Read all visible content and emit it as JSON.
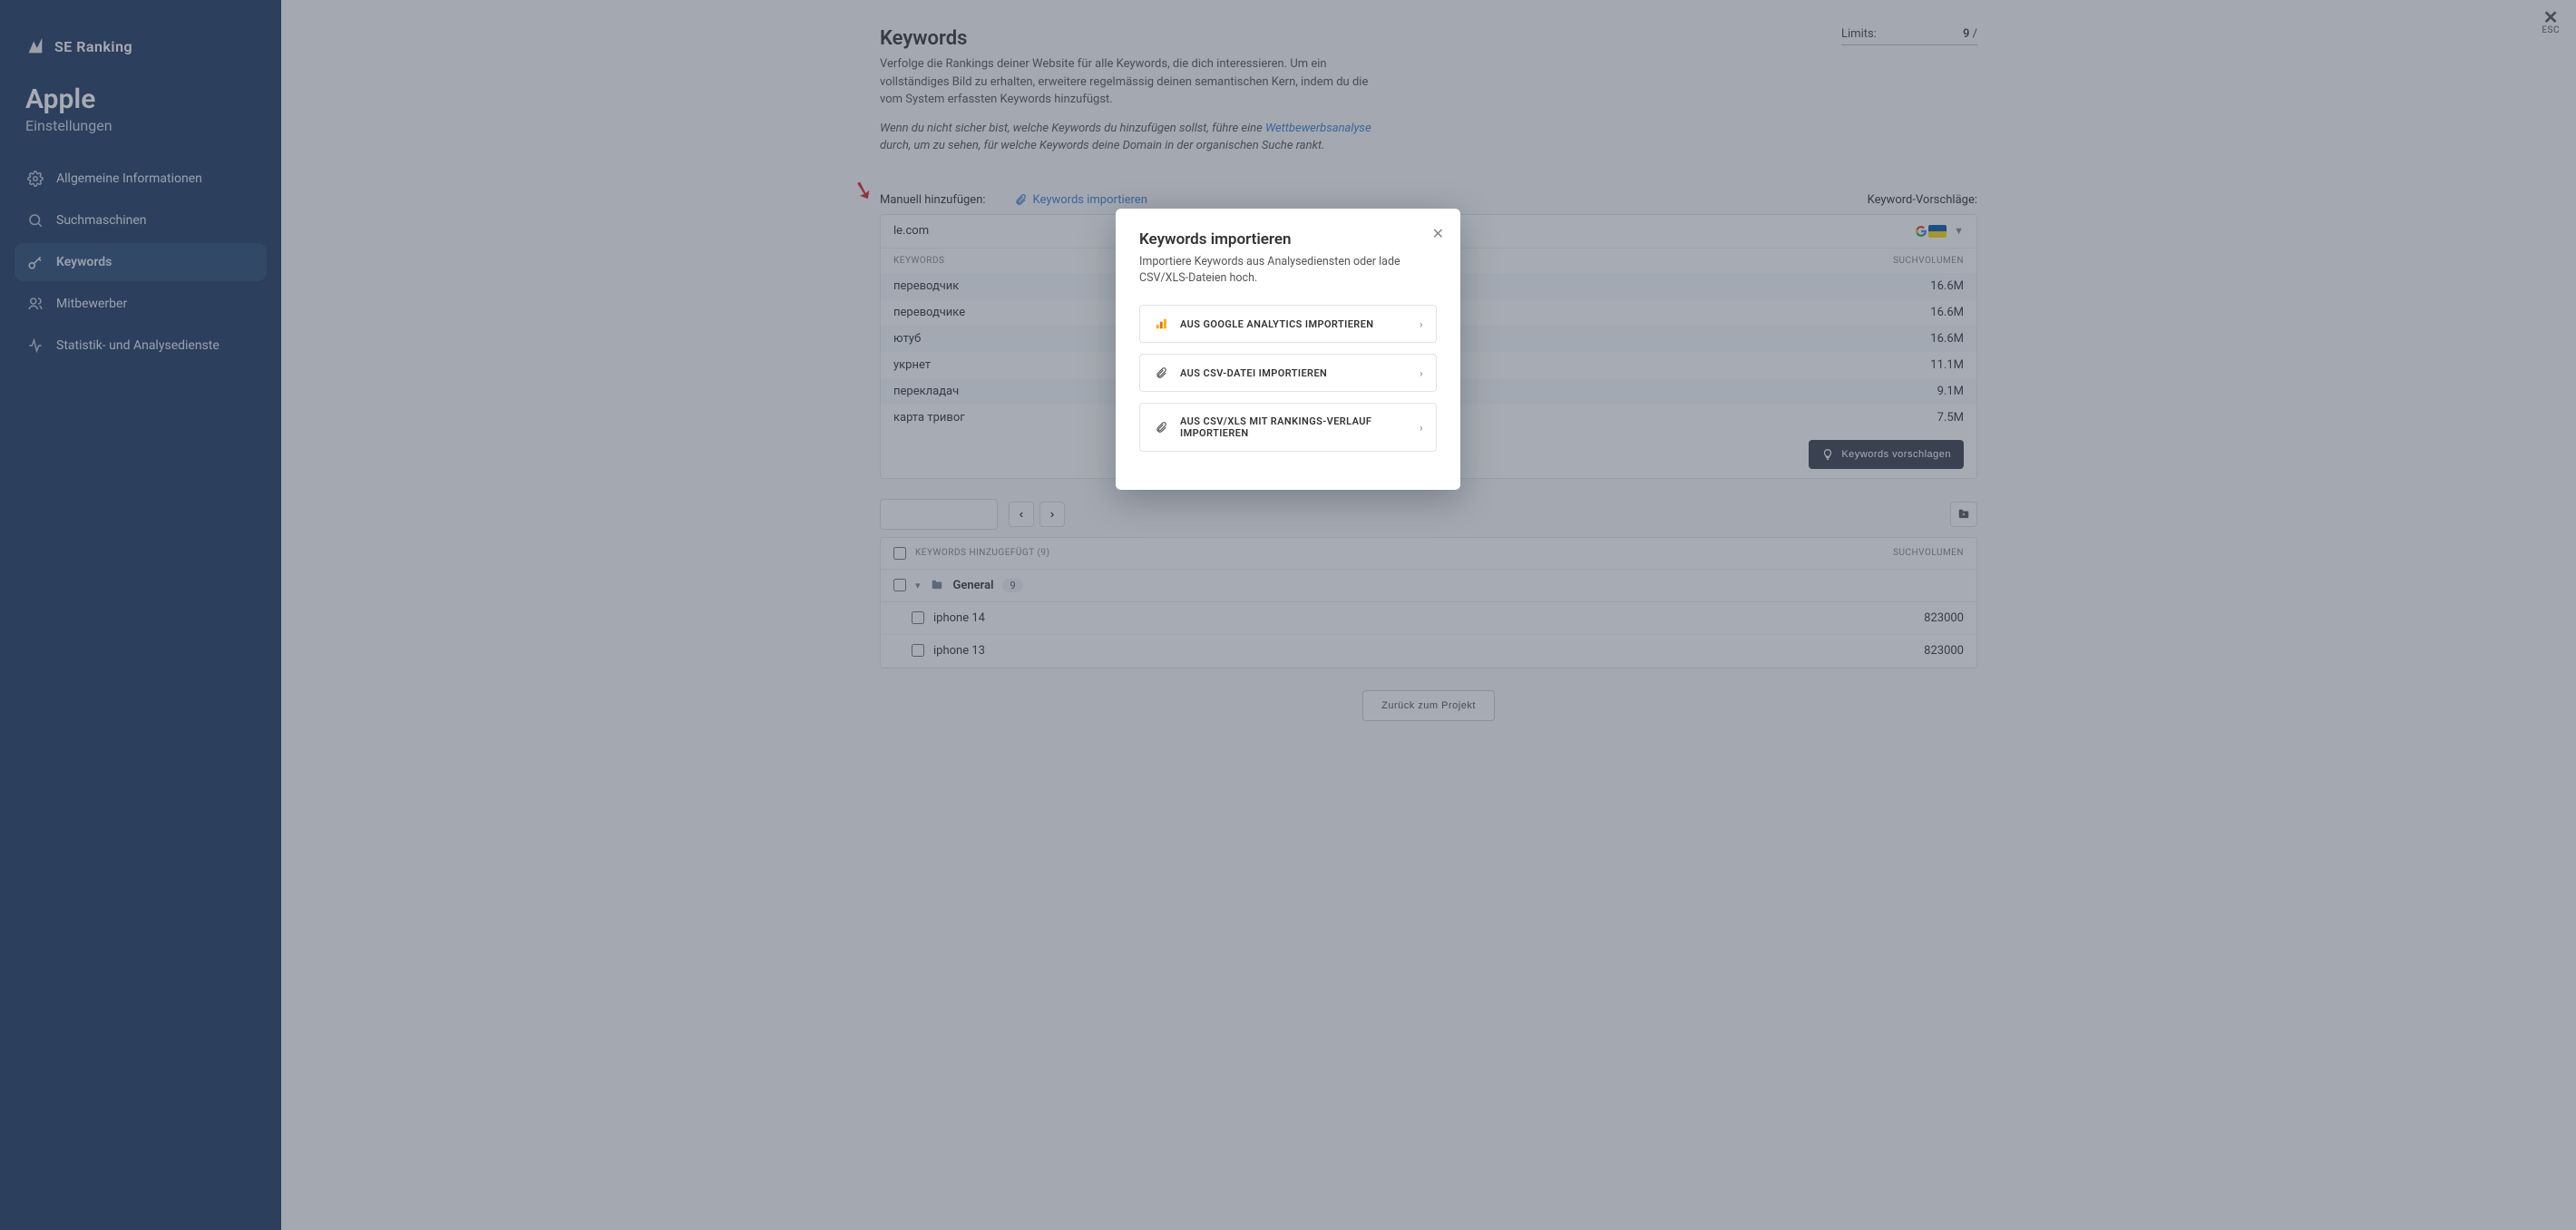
{
  "brand": {
    "name": "SE Ranking"
  },
  "project": {
    "title": "Apple",
    "subtitle": "Einstellungen"
  },
  "sidebar": {
    "items": [
      {
        "label": "Allgemeine Informationen"
      },
      {
        "label": "Suchmaschinen"
      },
      {
        "label": "Keywords"
      },
      {
        "label": "Mitbewerber"
      },
      {
        "label": "Statistik- und Analysedienste"
      }
    ]
  },
  "close_hint": "ESC",
  "header": {
    "title": "Keywords",
    "p1": "Verfolge die Rankings deiner Website für alle Keywords, die dich interessieren. Um ein vollständiges Bild zu erhalten, erweitere regelmässig deinen semantischen Kern, indem du die vom System erfassten Keywords hinzufügst.",
    "p2a": "Wenn du nicht sicher bist, welche Keywords du hinzufügen sollst, führe eine ",
    "p2link": "Wettbewerbsanalyse",
    "p2b": " durch, um zu sehen, für welche Keywords deine Domain in der organischen Suche rankt."
  },
  "limits": {
    "label": "Limits:",
    "value": "9",
    "slash": "/"
  },
  "addbar": {
    "manual": "Manuell hinzufügen:",
    "import": "Keywords importieren",
    "suggest": "Keyword-Vorschläge:"
  },
  "domain": "le.com",
  "sugg_table": {
    "head_kw": "Keywords",
    "head_vol": "Suchvolumen",
    "rows": [
      {
        "kw": "переводчик",
        "vol": "16.6M"
      },
      {
        "kw": "переводчике",
        "vol": "16.6M"
      },
      {
        "kw": "ютуб",
        "vol": "16.6M"
      },
      {
        "kw": "укрнет",
        "vol": "11.1M"
      },
      {
        "kw": "перекладач",
        "vol": "9.1M"
      },
      {
        "kw": "карта тривог",
        "vol": "7.5M"
      }
    ]
  },
  "suggest_btn": "Keywords vorschlagen",
  "added": {
    "head_kw": "Keywords hinzugefügt (9)",
    "head_vol": "Suchvolumen",
    "group": {
      "name": "General",
      "count": "9"
    },
    "rows": [
      {
        "kw": "iphone 14",
        "vol": "823000"
      },
      {
        "kw": "iphone 13",
        "vol": "823000"
      }
    ]
  },
  "footer": {
    "back": "Zurück zum Projekt"
  },
  "modal": {
    "title": "Keywords importieren",
    "desc": "Importiere Keywords aus Analysediensten oder lade CSV/XLS-Dateien hoch.",
    "opt1": "Aus Google Analytics importieren",
    "opt2": "Aus CSV-Datei importieren",
    "opt3": "Aus CSV/XLS mit Rankings-Verlauf importieren"
  }
}
